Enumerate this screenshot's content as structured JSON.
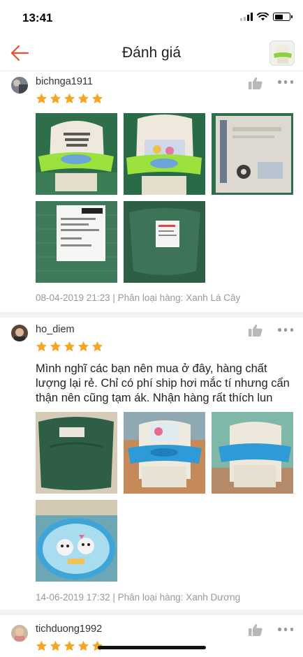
{
  "status": {
    "time": "13:41",
    "battery_level": 0.55
  },
  "nav": {
    "title": "Đánh giá",
    "back_icon": "arrow-left-icon",
    "accent_color": "#ee4d2d"
  },
  "reviews": [
    {
      "username": "bichnga1911",
      "rating": 5,
      "text": "",
      "photos": [
        "green-chair-front",
        "green-chair-tray",
        "cardboard-box",
        "shipping-label-bag",
        "green-bag-label"
      ],
      "date": "08-04-2019 21:23",
      "variant": "Phân loại hàng: Xanh Lá Cây",
      "separator": " | "
    },
    {
      "username": "ho_diem",
      "rating": 5,
      "text": "Mình nghĩ các bạn nên mua ở đây, hàng chất lượng lại rẻ. Chỉ có phí ship hơi mắc tí nhưng cẩn thận nên cũng tạm ák. Nhận hàng rất thích lun",
      "photos": [
        "green-bag",
        "blue-chair-tray",
        "blue-chair-side",
        "cartoon-cushion"
      ],
      "date": "14-06-2019 17:32",
      "variant": "Phân loại hàng: Xanh Dương",
      "separator": " | "
    },
    {
      "username": "tichduong1992",
      "rating": 5
    }
  ],
  "colors": {
    "star": "#f5a623",
    "meta_text": "#999999",
    "divider": "#f2f2f2"
  }
}
